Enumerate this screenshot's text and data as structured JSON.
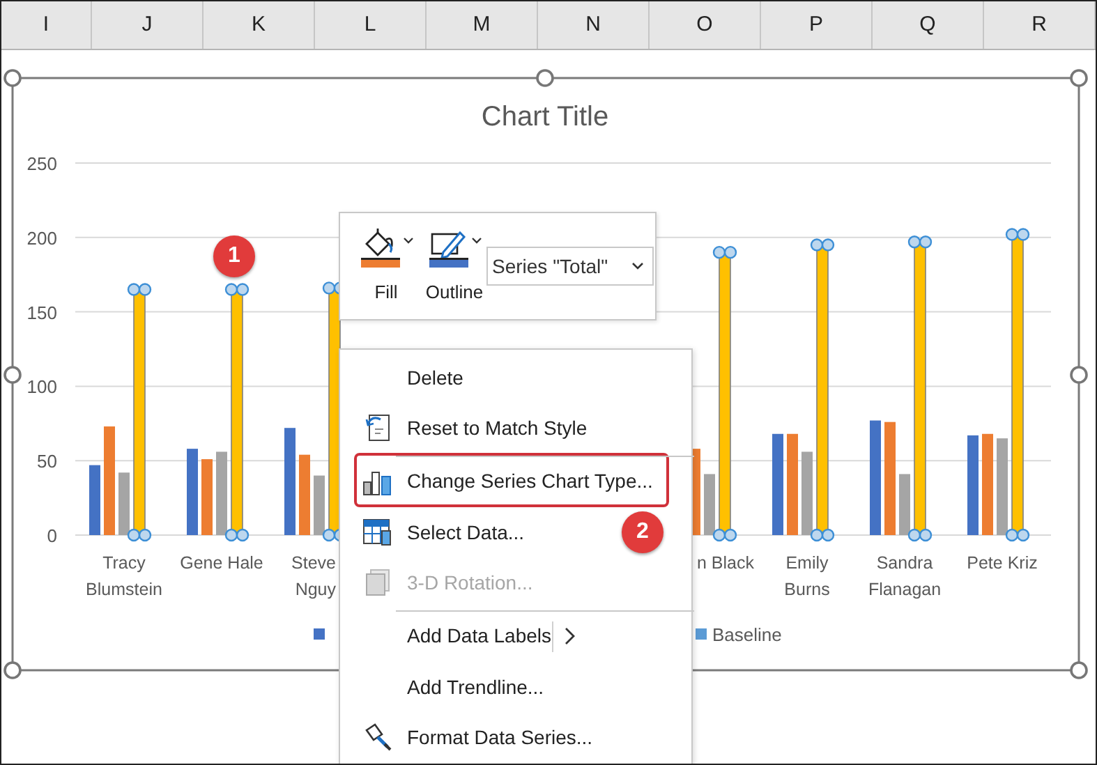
{
  "column_headers": [
    "I",
    "J",
    "K",
    "L",
    "M",
    "N",
    "O",
    "P",
    "Q",
    "R"
  ],
  "chart": {
    "title": "Chart Title",
    "chart_data": {
      "type": "bar",
      "grid": true,
      "categories": [
        "Tracy Blumstein",
        "Gene Hale",
        "Steve Nguy",
        null,
        null,
        null,
        "n Black",
        "Emily Burns",
        "Sandra Flanagan",
        "Pete Kriz"
      ],
      "ylim": [
        0,
        250
      ],
      "yticks": [
        0,
        50,
        100,
        150,
        200,
        250
      ],
      "series": [
        {
          "color": "#4472c4",
          "values": [
            47,
            58,
            72,
            null,
            null,
            null,
            null,
            68,
            77,
            67
          ]
        },
        {
          "color": "#ed7d31",
          "values": [
            73,
            51,
            54,
            null,
            null,
            null,
            58,
            68,
            76,
            68
          ]
        },
        {
          "color": "#a5a5a5",
          "values": [
            42,
            56,
            40,
            null,
            null,
            null,
            41,
            56,
            41,
            65
          ]
        },
        {
          "color": "#ffc000",
          "values": [
            165,
            165,
            166,
            null,
            null,
            null,
            190,
            195,
            197,
            202
          ]
        }
      ]
    },
    "series_selected": [
      false,
      false,
      false,
      true
    ],
    "legend": [
      {
        "color": "#4472c4"
      },
      {
        "label": "Baseline",
        "color": "#5b9bd5"
      }
    ]
  },
  "mini_toolbar": {
    "buttons": [
      {
        "label": "Fill",
        "kind": "fill",
        "color": "#ed7d31"
      },
      {
        "label": "Outline",
        "kind": "outline",
        "color": "#4472c4"
      }
    ],
    "series_select": {
      "value": "Series \"Total\""
    }
  },
  "context_menu": {
    "items": [
      {
        "label": "Delete",
        "kind": "none",
        "disabled": false,
        "highlighted": false,
        "submenu": false,
        "separator_before": false
      },
      {
        "label": "Reset to Match Style",
        "kind": "reset",
        "disabled": false,
        "highlighted": false,
        "submenu": false,
        "separator_before": false
      },
      {
        "label": "Change Series Chart Type...",
        "kind": "chart-type",
        "disabled": false,
        "highlighted": true,
        "submenu": false,
        "separator_before": true
      },
      {
        "label": "Select Data...",
        "kind": "select-data",
        "disabled": false,
        "highlighted": false,
        "submenu": false,
        "separator_before": false
      },
      {
        "label": "3-D Rotation...",
        "kind": "rotation",
        "disabled": true,
        "highlighted": false,
        "submenu": false,
        "separator_before": false
      },
      {
        "label": "Add Data Labels",
        "kind": "none",
        "disabled": false,
        "highlighted": false,
        "submenu": true,
        "separator_before": true
      },
      {
        "label": "Add Trendline...",
        "kind": "none",
        "disabled": false,
        "highlighted": false,
        "submenu": false,
        "separator_before": false
      },
      {
        "label": "Format Data Series...",
        "kind": "format",
        "disabled": false,
        "highlighted": false,
        "submenu": false,
        "separator_before": false
      }
    ]
  },
  "callouts": [
    {
      "label": "1"
    },
    {
      "label": "2"
    }
  ]
}
